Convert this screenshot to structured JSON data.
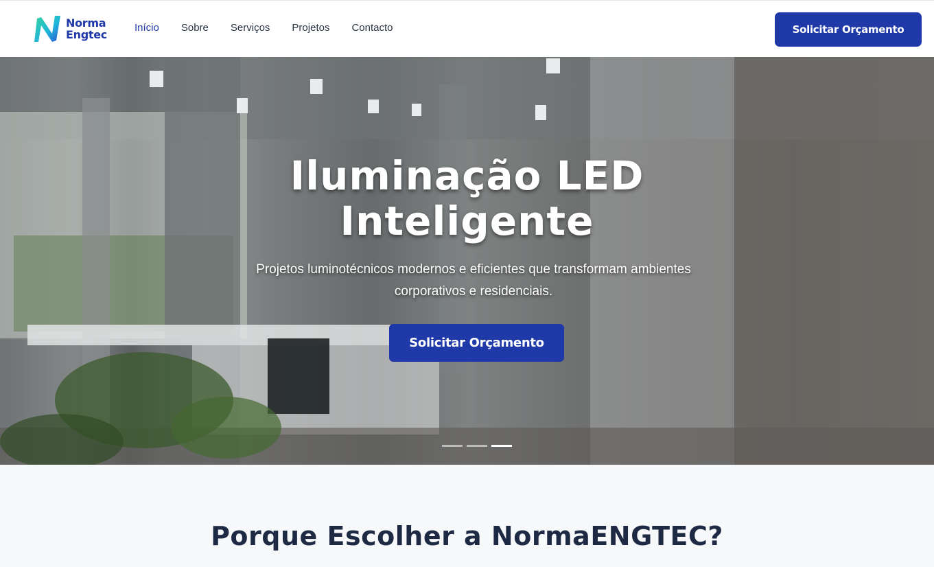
{
  "brand": {
    "name_line1": "Norma",
    "name_line2": "Engtec",
    "accent": "#1f3aa8",
    "logo_gradient": [
      "#38d39f",
      "#1fb8d8",
      "#2c52d6"
    ]
  },
  "nav": {
    "items": [
      {
        "label": "Início",
        "active": true
      },
      {
        "label": "Sobre"
      },
      {
        "label": "Serviços"
      },
      {
        "label": "Projetos"
      },
      {
        "label": "Contacto"
      }
    ]
  },
  "header_cta": "Solicitar Orçamento",
  "hero": {
    "title_line1": "Iluminação LED",
    "title_line2": "Inteligente",
    "subtitle": "Projetos luminotécnicos modernos e eficientes que transformam ambientes corporativos e residenciais.",
    "cta": "Solicitar Orçamento",
    "slides_total": 3,
    "active_slide": 3
  },
  "section": {
    "title": "Porque Escolher a NormaENGTEC?"
  }
}
